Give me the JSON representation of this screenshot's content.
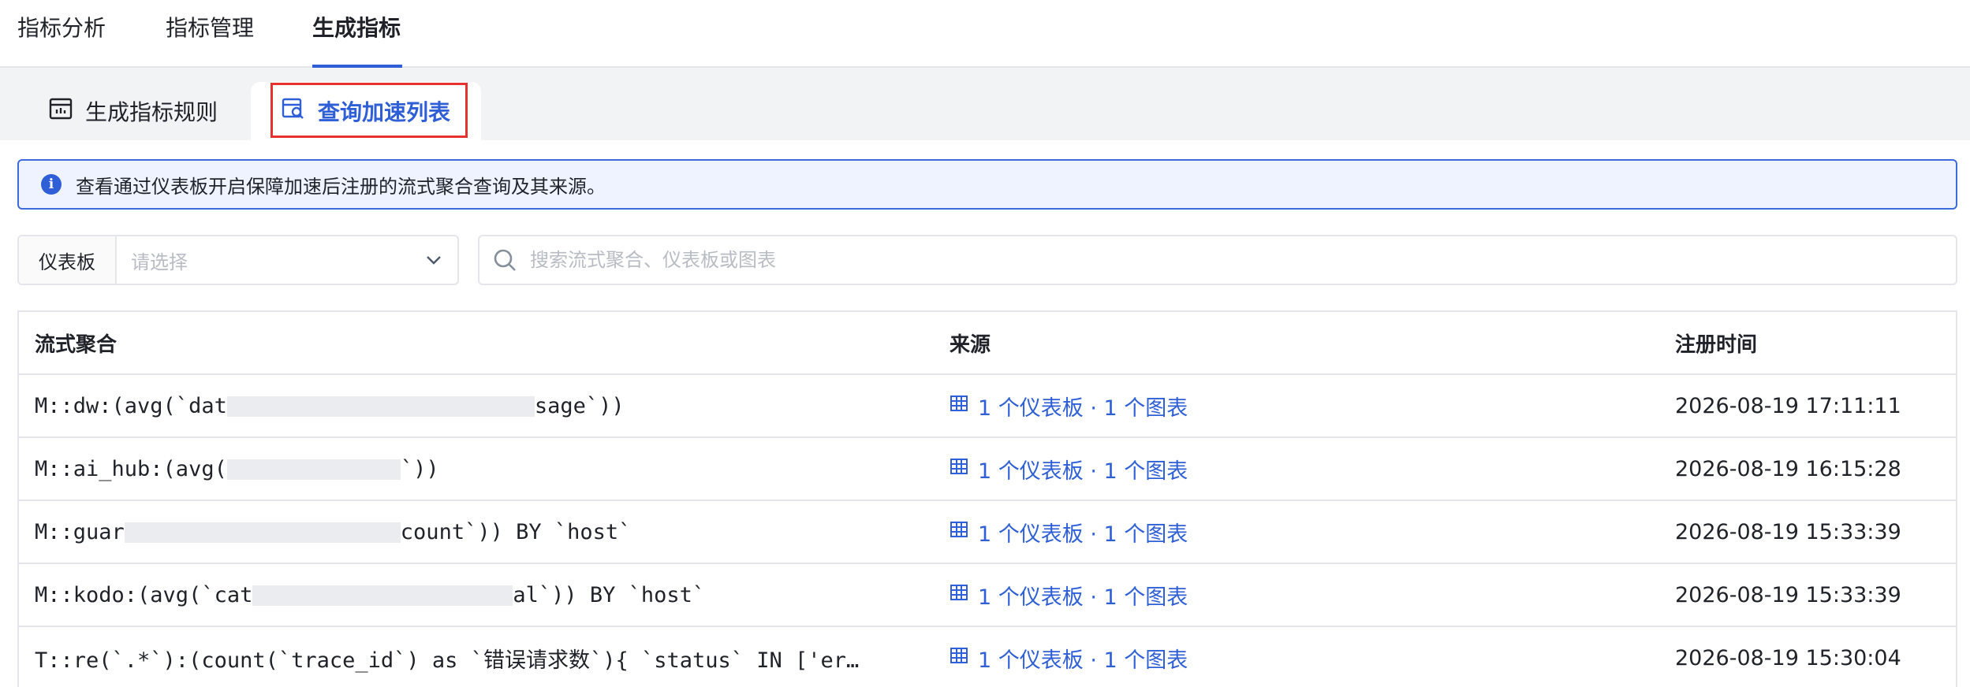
{
  "top_tabs": [
    {
      "label": "指标分析"
    },
    {
      "label": "指标管理"
    },
    {
      "label": "生成指标"
    }
  ],
  "sub_tabs": [
    {
      "label": "生成指标规则",
      "icon": "chart-board-icon"
    },
    {
      "label": "查询加速列表",
      "icon": "accelerated-query-icon"
    }
  ],
  "info_banner": {
    "text": "查看通过仪表板开启保障加速后注册的流式聚合查询及其来源。"
  },
  "filters": {
    "dashboard_label": "仪表板",
    "dashboard_placeholder": "请选择",
    "search_placeholder": "搜索流式聚合、仪表板或图表"
  },
  "table": {
    "columns": [
      "流式聚合",
      "来源",
      "注册时间"
    ],
    "rows": [
      {
        "agg_prefix": "M::dw:(avg(`dat",
        "agg_suffix": "sage`))",
        "source": "1 个仪表板 · 1 个图表",
        "time": "2026-08-19 17:11:11"
      },
      {
        "agg_prefix": "M::ai_hub:(avg(",
        "agg_suffix": "`))",
        "source": "1 个仪表板 · 1 个图表",
        "time": "2026-08-19 16:15:28"
      },
      {
        "agg_prefix": "M::guar",
        "agg_suffix": "count`)) BY `host`",
        "source": "1 个仪表板 · 1 个图表",
        "time": "2026-08-19 15:33:39"
      },
      {
        "agg_prefix": "M::kodo:(avg(`cat",
        "agg_suffix": "al`)) BY `host`",
        "source": "1 个仪表板 · 1 个图表",
        "time": "2026-08-19 15:33:39"
      },
      {
        "agg_prefix": "T::re(`.*`):(count(`trace_id`) as `错误请求数`){ `status` IN ['er…",
        "agg_suffix": "",
        "source": "1 个仪表板 · 1 个图表",
        "time": "2026-08-19 15:30:04"
      }
    ]
  },
  "colors": {
    "accent": "#2f5fd6",
    "highlight": "#e5322d",
    "banner_bg": "#eef3ff"
  }
}
